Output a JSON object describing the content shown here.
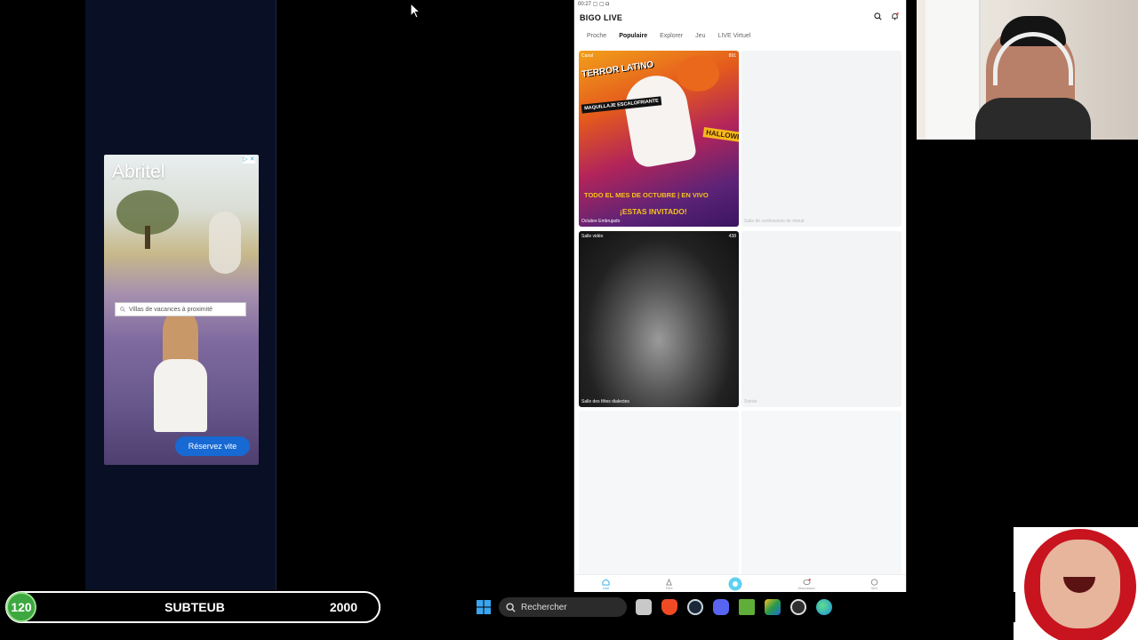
{
  "ad": {
    "logo": "Abritel",
    "badge": "▷ ✕",
    "search_placeholder": "Villas de vacances à proximité",
    "cta": "Réservez vite"
  },
  "phone": {
    "status": "00:27 ▢ ▢ ◘",
    "app_title": "BIGO LIVE",
    "tabs": [
      "Proche",
      "Populaire",
      "Explorer",
      "Jeu",
      "LIVE Virtuel"
    ],
    "active_tab": "Populaire",
    "cards": [
      {
        "tag": "Canal",
        "viewers": "891",
        "label": "Octubre Embrujado",
        "poster": {
          "headline": "TERROR LATINO",
          "sub1": "MAQUILLAJE ESCALOFRIANTE",
          "sub2": "HALLOWEEN",
          "bottom1": "TODO EL MES DE OCTUBRE | EN VIVO",
          "bottom2": "¡ESTAS INVITADO!"
        }
      },
      {
        "tag": "",
        "viewers": "",
        "label": "Salle de confessions de minuit"
      },
      {
        "tag": "Salle vidéo",
        "viewers": "438",
        "label": "Salle des fêtes dialectes"
      },
      {
        "tag": "",
        "viewers": "",
        "label": "Soirée"
      },
      {
        "tag": "",
        "viewers": "",
        "label": ""
      },
      {
        "tag": "",
        "viewers": "",
        "label": ""
      }
    ],
    "bottom_nav": [
      "Live",
      "Fête",
      "",
      "Discussion",
      "Moi"
    ]
  },
  "subgoal": {
    "count": "120",
    "label": "SUBTEUB",
    "goal": "2000"
  },
  "taskbar": {
    "search_label": "Rechercher",
    "icons": [
      "windows-icon",
      "file-explorer-icon",
      "brave-icon",
      "steam-icon",
      "discord-icon",
      "minecraft-icon",
      "bluestacks-icon",
      "obs-icon",
      "edge-icon"
    ]
  },
  "colors": {
    "left_panel_bg": "#090f24",
    "cta_blue": "#1769d4",
    "subgoal_green": "#3ca83f",
    "hood_red": "#c7141f"
  }
}
